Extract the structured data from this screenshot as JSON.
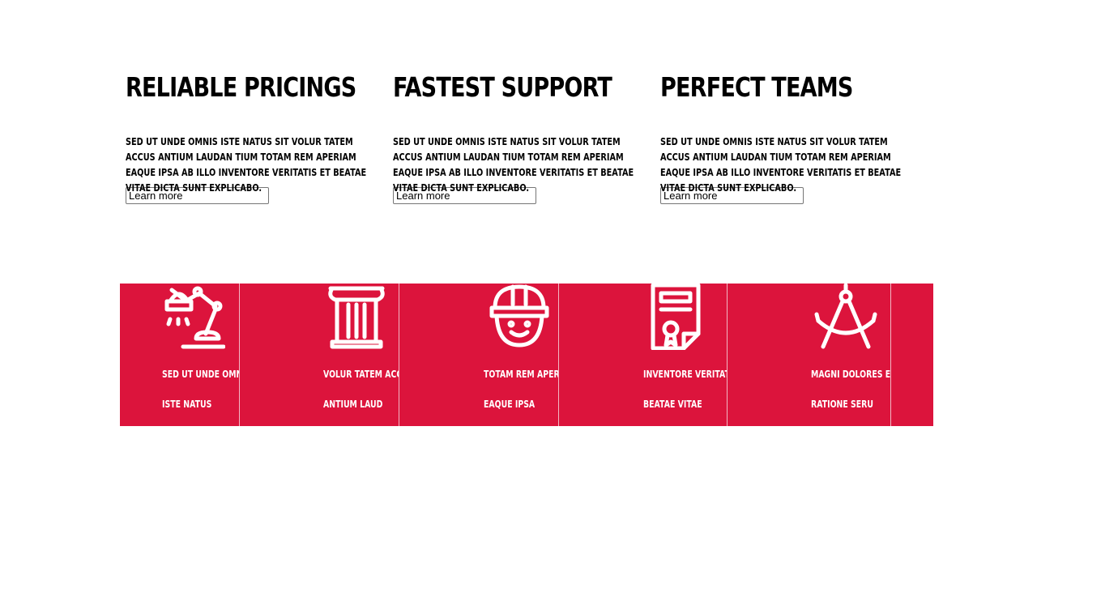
{
  "features": [
    {
      "title": "RELIABLE PRICINGS",
      "text": "SED UT UNDE OMNIS ISTE NATUS SIT VOLUR TATEM ACCUS ANTIUM LAUDAN TIUM TOTAM REM APERIAM EAQUE IPSA AB ILLO INVENTORE VERITATIS ET BEATAE VITAE DICTA SUNT EXPLICABO.",
      "button": "Learn more"
    },
    {
      "title": "FASTEST SUPPORT",
      "text": "SED UT UNDE OMNIS ISTE NATUS SIT VOLUR TATEM ACCUS ANTIUM LAUDAN TIUM TOTAM REM APERIAM EAQUE IPSA AB ILLO INVENTORE VERITATIS ET BEATAE VITAE DICTA SUNT EXPLICABO.",
      "button": "Learn more"
    },
    {
      "title": "PERFECT TEAMS",
      "text": "SED UT UNDE OMNIS ISTE NATUS SIT VOLUR TATEM ACCUS ANTIUM LAUDAN TIUM TOTAM REM APERIAM EAQUE IPSA AB ILLO INVENTORE VERITATIS ET BEATAE VITAE DICTA SUNT EXPLICABO.",
      "button": "Learn more"
    }
  ],
  "band": {
    "color": "#dc143c",
    "items": [
      {
        "icon": "desk-lamp-icon",
        "line1": "SED UT UNDE OMNIS",
        "line2": "ISTE NATUS"
      },
      {
        "icon": "column-pillar-icon",
        "line1": "VOLUR TATEM ACCUS",
        "line2": "ANTIUM LAUD"
      },
      {
        "icon": "worker-helmet-icon",
        "line1": "TOTAM REM APERIAM",
        "line2": "EAQUE IPSA"
      },
      {
        "icon": "certificate-icon",
        "line1": "INVENTORE VERITATIS",
        "line2": "BEATAE VITAE"
      },
      {
        "icon": "drafting-compass-icon",
        "line1": "MAGNI DOLORES EOS",
        "line2": "RATIONE SERU"
      }
    ]
  }
}
